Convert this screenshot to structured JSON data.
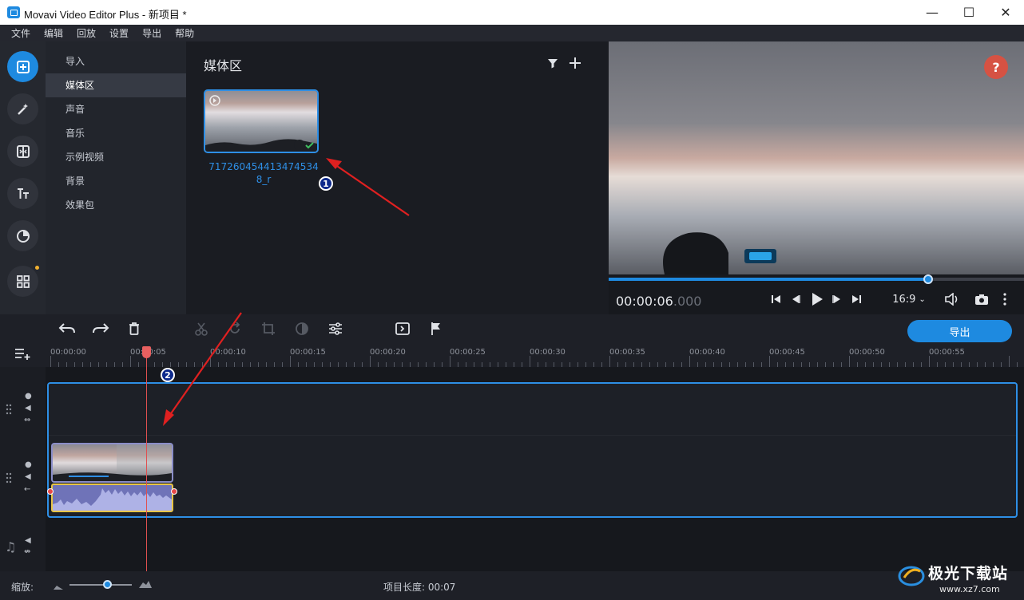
{
  "window": {
    "title": "Movavi Video Editor Plus - 新项目 *",
    "minimize": "—",
    "maximize": "☐",
    "close": "✕"
  },
  "menu": [
    "文件",
    "编辑",
    "回放",
    "设置",
    "导出",
    "帮助"
  ],
  "sidebar_icons": [
    "import-icon",
    "magic-wand-icon",
    "transitions-icon",
    "titles-icon",
    "stickers-icon",
    "more-tools-icon"
  ],
  "categories": [
    "导入",
    "媒体区",
    "声音",
    "音乐",
    "示例视频",
    "背景",
    "效果包"
  ],
  "media": {
    "title": "媒体区",
    "item_name_line1": "717260454413474534",
    "item_name_line2": "8_r"
  },
  "preview": {
    "timecode_main": "00:00:06",
    "timecode_frac": ".000",
    "aspect_ratio": "16:9",
    "help": "?",
    "progress_fraction": 0.77
  },
  "toolbar": {
    "export_label": "导出"
  },
  "ruler": [
    "00:00:00",
    "00:00:05",
    "00:00:10",
    "00:00:15",
    "00:00:20",
    "00:00:25",
    "00:00:30",
    "00:00:35",
    "00:00:40",
    "00:00:45",
    "00:00:50",
    "00:00:55"
  ],
  "status": {
    "zoom_label": "缩放:",
    "project_length": "项目长度: 00:07"
  },
  "annotations": {
    "badge1": "1",
    "badge2": "2"
  },
  "watermark": {
    "text": "极光下载站",
    "url": "www.xz7.com"
  },
  "colors": {
    "accent": "#1e8ae0",
    "help": "#d65243",
    "playhead": "#e05050",
    "annotation": "#e02020"
  }
}
